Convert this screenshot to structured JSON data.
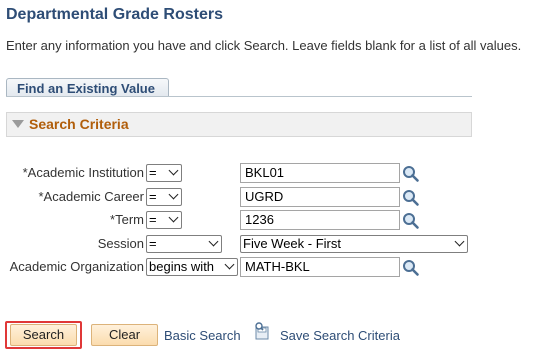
{
  "page": {
    "title": "Departmental Grade Rosters",
    "instructions": "Enter any information you have and click Search. Leave fields blank for a list of all values."
  },
  "tabs": [
    {
      "label": "Find an Existing Value"
    }
  ],
  "section": {
    "title": "Search Criteria"
  },
  "fields": [
    {
      "label": "*Academic Institution",
      "operator": "=",
      "value": "BKL01",
      "lookup_icon": "search-icon"
    },
    {
      "label": "*Academic Career",
      "operator": "=",
      "value": "UGRD",
      "lookup_icon": "search-icon"
    },
    {
      "label": "*Term",
      "operator": "=",
      "value": "1236",
      "lookup_icon": "search-icon"
    },
    {
      "label": "Session",
      "operator": "=",
      "value": "Five Week - First"
    },
    {
      "label": "Academic Organization",
      "operator": "begins with",
      "value": "MATH-BKL",
      "lookup_icon": "search-icon"
    }
  ],
  "buttons": {
    "search": "Search",
    "clear": "Clear",
    "basic_search": "Basic Search",
    "save_search": "Save Search Criteria"
  },
  "colors": {
    "title": "#2e4d76",
    "section_title": "#b15e0b",
    "button_bg": "#fbdcae",
    "highlight": "#e03838"
  }
}
